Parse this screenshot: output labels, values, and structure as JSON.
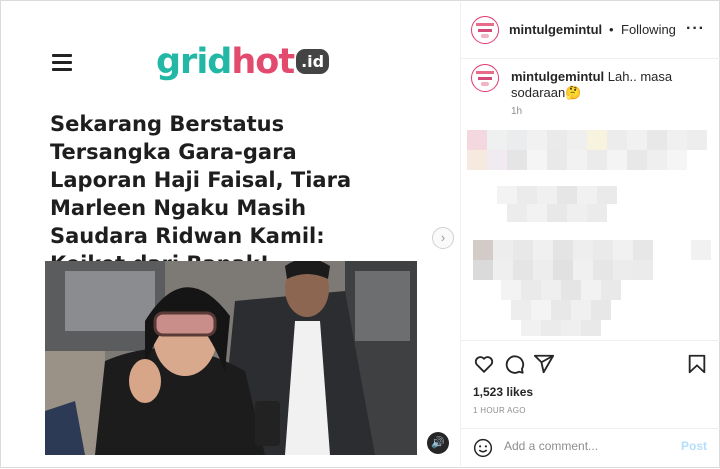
{
  "article": {
    "logo": {
      "part1": "grid",
      "part2": "hot",
      "part3": ".id"
    },
    "headline": "Sekarang Berstatus Tersangka Gara-gara Laporan Haji Faisal, Tiara Marleen Ngaku Masih Saudara Ridwan Kamil: Keiket dari Bapak!"
  },
  "post": {
    "header": {
      "username": "mintulgemintul",
      "separator": "•",
      "follow_label": "Following",
      "more_label": "···"
    },
    "caption": {
      "username": "mintulgemintul",
      "text": "Lah.. masa sodaraan🤔"
    },
    "caption_time": "1h",
    "likes": "1,523 likes",
    "time_ago": "1 HOUR AGO",
    "comment_placeholder": "Add a comment...",
    "post_label": "Post"
  },
  "icons": [
    "menu-icon",
    "chevron-right-icon",
    "speaker-icon",
    "heart-icon",
    "comment-icon",
    "share-icon",
    "bookmark-icon",
    "emoji-icon",
    "more-icon"
  ]
}
